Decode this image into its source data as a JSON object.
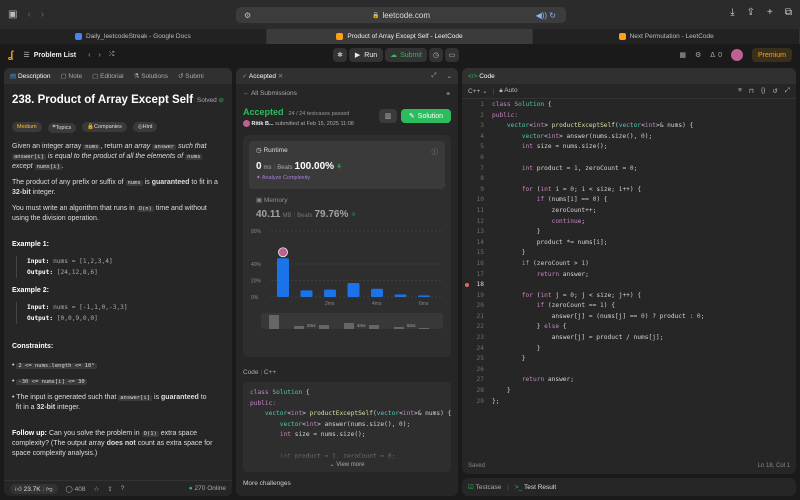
{
  "browser": {
    "url": "leetcode.com",
    "tabs": [
      {
        "label": "Daily_leetcodeStreak - Google Docs",
        "active": false,
        "color": "#4285f4"
      },
      {
        "label": "Product of Array Except Self - LeetCode",
        "active": true,
        "color": "#ffa116"
      },
      {
        "label": "Next Permutation - LeetCode",
        "active": false,
        "color": "#ffa116"
      }
    ]
  },
  "nav": {
    "problem_list": "Problem List",
    "run": "Run",
    "submit": "Submit",
    "streak": "0",
    "premium": "Premium"
  },
  "left": {
    "tabs": [
      "Description",
      "Note",
      "Editorial",
      "Solutions",
      "Submi"
    ],
    "title": "238. Product of Array Except Self",
    "solved": "Solved",
    "tags": [
      "Medium",
      "Topics",
      "Companies",
      "Hint"
    ],
    "p1a": "Given an integer array",
    "p1_nums": "nums",
    "p1b": ", return",
    "p1c": "an array",
    "p1_answer": "answer",
    "p1d": "such that",
    "p1_answeri": "answer[i]",
    "p1e": "is equal to the product of all the elements of",
    "p1_nums2": "nums",
    "p1f": "except",
    "p1_numsi": "nums[i]",
    "p1g": ".",
    "p2a": "The product of any prefix or suffix of",
    "p2_nums": "nums",
    "p2b": "is",
    "p2c": "guaranteed",
    "p2d": "to fit in a",
    "p2e": "32-bit",
    "p2f": "integer.",
    "p3a": "You must write an algorithm that runs in",
    "p3_on": "O(n)",
    "p3b": "time and without",
    "p3c": "using the division operation.",
    "ex1": "Example 1:",
    "ex1_in_label": "Input:",
    "ex1_in": "nums = [1,2,3,4]",
    "ex1_out_label": "Output:",
    "ex1_out": "[24,12,8,6]",
    "ex2": "Example 2:",
    "ex2_in_label": "Input:",
    "ex2_in": "nums = [-1,1,0,-3,3]",
    "ex2_out_label": "Output:",
    "ex2_out": "[0,0,9,0,0]",
    "constraints": "Constraints:",
    "c1": "2 <= nums.length <= 10⁵",
    "c2": "-30 <= nums[i] <= 30",
    "c3a": "The input is generated such that",
    "c3_answeri": "answer[i]",
    "c3b": "is",
    "c3c": "guaranteed",
    "c3d": "to",
    "c3e": "fit in a",
    "c3f": "32-bit",
    "c3g": "integer.",
    "fu_label": "Follow up:",
    "fu_a": "Can you solve the problem in",
    "fu_o1": "O(1)",
    "fu_b": "extra space",
    "fu_c": "complexity? (The output array",
    "fu_d": "does not",
    "fu_e": "count as extra space for",
    "fu_f": "space complexity analysis.)",
    "likes": "23.7K",
    "comments": "408",
    "online": "270 Online"
  },
  "middle": {
    "tab": "Accepted",
    "back": "All Submissions",
    "status": "Accepted",
    "passed": "24 / 24 testcases passed",
    "user": "Ritik B...",
    "submitted": "submitted at Feb 15, 2025 11:08",
    "solution_btn": "Solution",
    "runtime_label": "Runtime",
    "runtime_value": "0",
    "runtime_unit": "ms",
    "beats_label": "Beats",
    "beats_value": "100.00%",
    "analyze": "Analyze Complexity",
    "memory_label": "Memory",
    "memory_value": "40.11",
    "memory_unit": "MB",
    "mem_beats_label": "Beats",
    "mem_beats_value": "79.76%",
    "code_label": "Code",
    "code_lang": "C++",
    "code_lines": [
      [
        [
          "class",
          "kw"
        ],
        [
          " ",
          "pl"
        ],
        [
          "Solution",
          "cl"
        ],
        [
          " {",
          "pl"
        ]
      ],
      [
        [
          "public:",
          "kw"
        ]
      ],
      [
        [
          "    vector",
          "ty"
        ],
        [
          "<",
          "pl"
        ],
        [
          "int",
          "kw"
        ],
        [
          "> ",
          "pl"
        ],
        [
          "productExceptSelf",
          "fn"
        ],
        [
          "(",
          "pl"
        ],
        [
          "vector",
          "ty"
        ],
        [
          "<",
          "pl"
        ],
        [
          "int",
          "kw"
        ],
        [
          ">& nums) {",
          "pl"
        ]
      ],
      [
        [
          "        vector",
          "ty"
        ],
        [
          "<",
          "pl"
        ],
        [
          "int",
          "kw"
        ],
        [
          "> answer(nums.size(), ",
          "pl"
        ],
        [
          "0",
          "nm"
        ],
        [
          ");",
          "pl"
        ]
      ],
      [
        [
          "        ",
          "pl"
        ],
        [
          "int",
          "kw"
        ],
        [
          " size = nums.size();",
          "pl"
        ]
      ],
      [
        [
          "",
          "pl"
        ]
      ],
      [
        [
          "        ",
          "pl"
        ],
        [
          "int",
          "kw"
        ],
        [
          " product = ",
          "pl"
        ],
        [
          "1",
          "nm"
        ],
        [
          ", zeroCount = ",
          "pl"
        ],
        [
          "0",
          "nm"
        ],
        [
          ";",
          "pl"
        ]
      ]
    ],
    "view_more": "View more",
    "more_challenges": "More challenges"
  },
  "chart_data": {
    "type": "bar",
    "yticks": [
      "80%",
      "40%",
      "20%",
      "0%"
    ],
    "ylim": [
      0,
      80
    ],
    "xticks": [
      "2ms",
      "4ms",
      "6ms"
    ],
    "values": [
      47,
      8,
      9,
      17,
      10,
      3,
      2
    ],
    "highlight_index": 0,
    "mini_xticks": [
      "2ms",
      "4ms",
      "6ms"
    ]
  },
  "right": {
    "tab": "Code",
    "lang": "C++",
    "auto": "Auto",
    "saved": "Saved",
    "cursor": "Ln 18, Col 1",
    "testcase": "Testcase",
    "test_result": "Test Result",
    "lines": [
      [
        [
          "class",
          "kw"
        ],
        [
          " ",
          "pl"
        ],
        [
          "Solution",
          "cl"
        ],
        [
          " {",
          "pl"
        ]
      ],
      [
        [
          "public:",
          "kw"
        ]
      ],
      [
        [
          "    vector",
          "ty"
        ],
        [
          "<",
          "pl"
        ],
        [
          "int",
          "kw"
        ],
        [
          "> ",
          "pl"
        ],
        [
          "productExceptSelf",
          "fn"
        ],
        [
          "(",
          "pl"
        ],
        [
          "vector",
          "ty"
        ],
        [
          "<",
          "pl"
        ],
        [
          "int",
          "kw"
        ],
        [
          ">& nums) {",
          "pl"
        ]
      ],
      [
        [
          "        vector",
          "ty"
        ],
        [
          "<",
          "pl"
        ],
        [
          "int",
          "kw"
        ],
        [
          "> answer(nums.size(), ",
          "pl"
        ],
        [
          "0",
          "nm"
        ],
        [
          ");",
          "pl"
        ]
      ],
      [
        [
          "        ",
          "pl"
        ],
        [
          "int",
          "kw"
        ],
        [
          " size = nums.size();",
          "pl"
        ]
      ],
      [
        [
          "",
          "pl"
        ]
      ],
      [
        [
          "        ",
          "pl"
        ],
        [
          "int",
          "kw"
        ],
        [
          " product = ",
          "pl"
        ],
        [
          "1",
          "nm"
        ],
        [
          ", zeroCount = ",
          "pl"
        ],
        [
          "0",
          "nm"
        ],
        [
          ";",
          "pl"
        ]
      ],
      [
        [
          "",
          "pl"
        ]
      ],
      [
        [
          "        ",
          "pl"
        ],
        [
          "for",
          "kw"
        ],
        [
          " (",
          "pl"
        ],
        [
          "int",
          "kw"
        ],
        [
          " i = ",
          "pl"
        ],
        [
          "0",
          "nm"
        ],
        [
          "; i < size; i++) {",
          "pl"
        ]
      ],
      [
        [
          "            ",
          "pl"
        ],
        [
          "if",
          "kw"
        ],
        [
          " (nums[i] == ",
          "pl"
        ],
        [
          "0",
          "nm"
        ],
        [
          ") {",
          "pl"
        ]
      ],
      [
        [
          "                zeroCount++;",
          "pl"
        ]
      ],
      [
        [
          "                ",
          "pl"
        ],
        [
          "continue",
          "kw"
        ],
        [
          ";",
          "pl"
        ]
      ],
      [
        [
          "            }",
          "pl"
        ]
      ],
      [
        [
          "            product *= nums[i];",
          "pl"
        ]
      ],
      [
        [
          "        }",
          "pl"
        ]
      ],
      [
        [
          "        ",
          "pl"
        ],
        [
          "if",
          "kw"
        ],
        [
          " (zeroCount > ",
          "pl"
        ],
        [
          "1",
          "nm"
        ],
        [
          ")",
          "pl"
        ]
      ],
      [
        [
          "            ",
          "pl"
        ],
        [
          "return",
          "kw"
        ],
        [
          " answer;",
          "pl"
        ]
      ],
      [
        [
          "",
          "pl"
        ]
      ],
      [
        [
          "        ",
          "pl"
        ],
        [
          "for",
          "kw"
        ],
        [
          " (",
          "pl"
        ],
        [
          "int",
          "kw"
        ],
        [
          " j = ",
          "pl"
        ],
        [
          "0",
          "nm"
        ],
        [
          "; j < size; j++) {",
          "pl"
        ]
      ],
      [
        [
          "            ",
          "pl"
        ],
        [
          "if",
          "kw"
        ],
        [
          " (zeroCount == ",
          "pl"
        ],
        [
          "1",
          "nm"
        ],
        [
          ") {",
          "pl"
        ]
      ],
      [
        [
          "                answer[j] = (nums[j] == ",
          "pl"
        ],
        [
          "0",
          "nm"
        ],
        [
          ") ? product : ",
          "pl"
        ],
        [
          "0",
          "nm"
        ],
        [
          ";",
          "pl"
        ]
      ],
      [
        [
          "            } ",
          "pl"
        ],
        [
          "else",
          "kw"
        ],
        [
          " {",
          "pl"
        ]
      ],
      [
        [
          "                answer[j] = product / nums[j];",
          "pl"
        ]
      ],
      [
        [
          "            }",
          "pl"
        ]
      ],
      [
        [
          "        }",
          "pl"
        ]
      ],
      [
        [
          "",
          "pl"
        ]
      ],
      [
        [
          "        ",
          "pl"
        ],
        [
          "return",
          "kw"
        ],
        [
          " answer;",
          "pl"
        ]
      ],
      [
        [
          "    }",
          "pl"
        ]
      ],
      [
        [
          "};",
          "pl"
        ]
      ]
    ]
  }
}
